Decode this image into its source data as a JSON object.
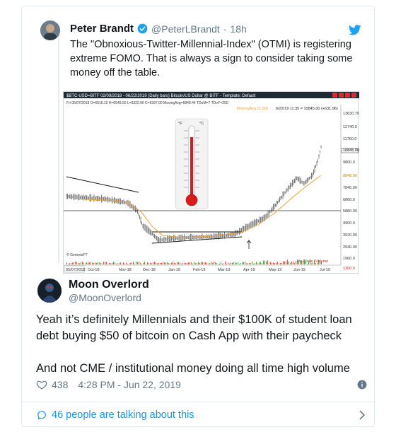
{
  "quoted_tweet": {
    "author_name": "Peter Brandt",
    "handle": "@PeterLBrandt",
    "time": "18h",
    "text": "The \"Obnoxious-Twitter-Millennial-Index\" (OTMI) is registering extreme FOMO. That is always a sign to consider taking some money off the table."
  },
  "chart": {
    "header_line1": "$BTC-USD=BITF  02/09/2018 - 06/22/2019 (Daily bars)  Bitcoin/US Dollar @ BITF  - Template: Default",
    "header_line2": "Fri  05/07/2018  O=6516.10 H=6549.50 L=6322.00 C=6397.00 MovingAvg=6848.44 TDoM=7 TDoY=250",
    "ma_label": "MovingAvg (C,50)",
    "cursor_label": "6/22/19 11:35 = 10845.00 (+631.96)",
    "y_ticks": [
      "13630.70",
      "12740.0",
      "11760.0",
      "10845.00",
      "9800.0",
      "8848.00",
      "7840.00",
      "6860.0",
      "5880.00",
      "4900.0",
      "3920.00",
      "2940.00",
      "1960.0",
      "1300.0"
    ],
    "x_ticks": [
      "05/07/2018",
      "Oct-18",
      "Nov-18",
      "Dec-18",
      "Jan-19",
      "Feb-19",
      "Mar-19",
      "Apr-19",
      "May-19",
      "Jun-19",
      "Jul-19"
    ],
    "watermark": "© GenesisFT",
    "legend_up": "Up Close",
    "legend_vol": "Volume",
    "thermo_f": "°F",
    "thermo_c": "°C"
  },
  "reply_tweet": {
    "author_name": "Moon Overlord",
    "handle": "@MoonOverlord",
    "paragraph1": "Yeah it’s definitely Millennials and their $100K of student loan debt buying $50 of bitcoin on Cash App with their paycheck",
    "paragraph2": "And not CME / institutional money doing all time high volume",
    "likes": "438",
    "timestamp": "4:28 PM - Jun 22, 2019"
  },
  "footer": {
    "talking_label": "46 people are talking about this"
  },
  "colors": {
    "accent": "#1b95e0",
    "secondary_text": "#657786",
    "ma_line": "#e8a33d",
    "price_bars": "#222222"
  },
  "icons": [
    "verified-badge-icon",
    "twitter-bird-icon",
    "heart-icon",
    "info-icon",
    "comment-bubble-icon",
    "chevron-right-icon"
  ]
}
